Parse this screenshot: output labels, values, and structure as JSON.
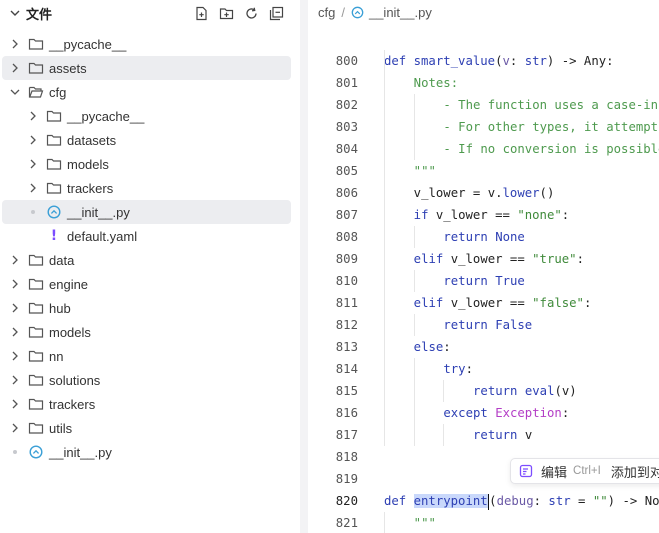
{
  "sidebar": {
    "title": "文件",
    "actions": [
      {
        "name": "new-file-icon"
      },
      {
        "name": "new-folder-icon"
      },
      {
        "name": "refresh-icon"
      },
      {
        "name": "collapse-all-icon"
      }
    ],
    "tree": [
      {
        "label": "__pycache__",
        "type": "folder",
        "level": 0,
        "expanded": false
      },
      {
        "label": "assets",
        "type": "folder",
        "level": 0,
        "expanded": false,
        "hover": true
      },
      {
        "label": "cfg",
        "type": "folder",
        "level": 0,
        "expanded": true
      },
      {
        "label": "__pycache__",
        "type": "folder",
        "level": 1,
        "expanded": false
      },
      {
        "label": "datasets",
        "type": "folder",
        "level": 1,
        "expanded": false
      },
      {
        "label": "models",
        "type": "folder",
        "level": 1,
        "expanded": false
      },
      {
        "label": "trackers",
        "type": "folder",
        "level": 1,
        "expanded": false
      },
      {
        "label": "__init__.py",
        "type": "python",
        "level": 1,
        "selected": true
      },
      {
        "label": "default.yaml",
        "type": "yaml",
        "level": 1
      },
      {
        "label": "data",
        "type": "folder",
        "level": 0,
        "expanded": false
      },
      {
        "label": "engine",
        "type": "folder",
        "level": 0,
        "expanded": false
      },
      {
        "label": "hub",
        "type": "folder",
        "level": 0,
        "expanded": false
      },
      {
        "label": "models",
        "type": "folder",
        "level": 0,
        "expanded": false
      },
      {
        "label": "nn",
        "type": "folder",
        "level": 0,
        "expanded": false
      },
      {
        "label": "solutions",
        "type": "folder",
        "level": 0,
        "expanded": false
      },
      {
        "label": "trackers",
        "type": "folder",
        "level": 0,
        "expanded": false
      },
      {
        "label": "utils",
        "type": "folder",
        "level": 0,
        "expanded": false
      },
      {
        "label": "__init__.py",
        "type": "python",
        "level": 0
      }
    ]
  },
  "breadcrumb": {
    "folder": "cfg",
    "separator": "/",
    "file": "__init__.py"
  },
  "editor": {
    "sticky_header": [
      {
        "t": "def ",
        "c": "kw"
      },
      {
        "t": "smart_value",
        "c": "fn"
      },
      {
        "t": "(",
        "c": ""
      },
      {
        "t": "v",
        "c": "prm"
      },
      {
        "t": ": ",
        "c": ""
      },
      {
        "t": "str",
        "c": "kw"
      },
      {
        "t": ") -> Any:",
        "c": ""
      }
    ],
    "lines": [
      {
        "n": "800",
        "indent": 1,
        "tokens": []
      },
      {
        "n": "801",
        "indent": 1,
        "tokens": [
          {
            "t": "Notes:",
            "c": "cm"
          }
        ]
      },
      {
        "n": "802",
        "indent": 2,
        "tokens": [
          {
            "t": "- The function uses a case-insensitive comparison",
            "c": "cm"
          }
        ]
      },
      {
        "n": "803",
        "indent": 2,
        "tokens": [
          {
            "t": "- For other types, it attempts to use eval()",
            "c": "cm"
          }
        ]
      },
      {
        "n": "804",
        "indent": 2,
        "tokens": [
          {
            "t": "- If no conversion is possible, returns the string",
            "c": "cm"
          }
        ]
      },
      {
        "n": "805",
        "indent": 1,
        "tokens": [
          {
            "t": "\"\"\"",
            "c": "cm"
          }
        ]
      },
      {
        "n": "806",
        "indent": 1,
        "tokens": [
          {
            "t": "v_lower = v.",
            "c": ""
          },
          {
            "t": "lower",
            "c": "fn"
          },
          {
            "t": "()",
            "c": ""
          }
        ]
      },
      {
        "n": "807",
        "indent": 1,
        "tokens": [
          {
            "t": "if ",
            "c": "kw"
          },
          {
            "t": "v_lower == ",
            "c": ""
          },
          {
            "t": "\"none\"",
            "c": "str"
          },
          {
            "t": ":",
            "c": ""
          }
        ]
      },
      {
        "n": "808",
        "indent": 2,
        "tokens": [
          {
            "t": "return ",
            "c": "kw"
          },
          {
            "t": "None",
            "c": "bool"
          }
        ]
      },
      {
        "n": "809",
        "indent": 1,
        "tokens": [
          {
            "t": "elif ",
            "c": "kw"
          },
          {
            "t": "v_lower == ",
            "c": ""
          },
          {
            "t": "\"true\"",
            "c": "str"
          },
          {
            "t": ":",
            "c": ""
          }
        ]
      },
      {
        "n": "810",
        "indent": 2,
        "tokens": [
          {
            "t": "return ",
            "c": "kw"
          },
          {
            "t": "True",
            "c": "bool"
          }
        ]
      },
      {
        "n": "811",
        "indent": 1,
        "tokens": [
          {
            "t": "elif ",
            "c": "kw"
          },
          {
            "t": "v_lower == ",
            "c": ""
          },
          {
            "t": "\"false\"",
            "c": "str"
          },
          {
            "t": ":",
            "c": ""
          }
        ]
      },
      {
        "n": "812",
        "indent": 2,
        "tokens": [
          {
            "t": "return ",
            "c": "kw"
          },
          {
            "t": "False",
            "c": "bool"
          }
        ]
      },
      {
        "n": "813",
        "indent": 1,
        "tokens": [
          {
            "t": "else",
            "c": "kw"
          },
          {
            "t": ":",
            "c": ""
          }
        ]
      },
      {
        "n": "814",
        "indent": 2,
        "tokens": [
          {
            "t": "try",
            "c": "kw"
          },
          {
            "t": ":",
            "c": ""
          }
        ]
      },
      {
        "n": "815",
        "indent": 3,
        "tokens": [
          {
            "t": "return ",
            "c": "kw"
          },
          {
            "t": "eval",
            "c": "fn"
          },
          {
            "t": "(v)",
            "c": ""
          }
        ]
      },
      {
        "n": "816",
        "indent": 2,
        "tokens": [
          {
            "t": "except ",
            "c": "kw"
          },
          {
            "t": "Exception",
            "c": "exc"
          },
          {
            "t": ":",
            "c": ""
          }
        ]
      },
      {
        "n": "817",
        "indent": 3,
        "tokens": [
          {
            "t": "return ",
            "c": "kw"
          },
          {
            "t": "v",
            "c": ""
          }
        ]
      },
      {
        "n": "818",
        "indent": 0,
        "tokens": []
      },
      {
        "n": "819",
        "indent": 0,
        "tokens": []
      },
      {
        "n": "820",
        "indent": 0,
        "active": true,
        "tokens": [
          {
            "t": "def ",
            "c": "kw"
          },
          {
            "t": "entrypoint",
            "c": "fn sel-word"
          },
          {
            "t": "CARET",
            "c": "caret"
          },
          {
            "t": "(",
            "c": ""
          },
          {
            "t": "debug",
            "c": "prm"
          },
          {
            "t": ": ",
            "c": ""
          },
          {
            "t": "str",
            "c": "kw"
          },
          {
            "t": " = ",
            "c": ""
          },
          {
            "t": "\"\"",
            "c": "str"
          },
          {
            "t": ") -> None:",
            "c": ""
          }
        ]
      },
      {
        "n": "821",
        "indent": 1,
        "tokens": [
          {
            "t": "\"\"\"",
            "c": "cm"
          }
        ]
      }
    ],
    "hint": {
      "label": "编辑",
      "shortcut": "Ctrl+I",
      "add_label": "添加到对话"
    }
  },
  "colors": {
    "accent": "#2d3fb3",
    "string": "#3f8a3a",
    "selection": "#c9d8fb",
    "python_icon": "#3a9fd6",
    "yaml_icon": "#7c4dff"
  }
}
